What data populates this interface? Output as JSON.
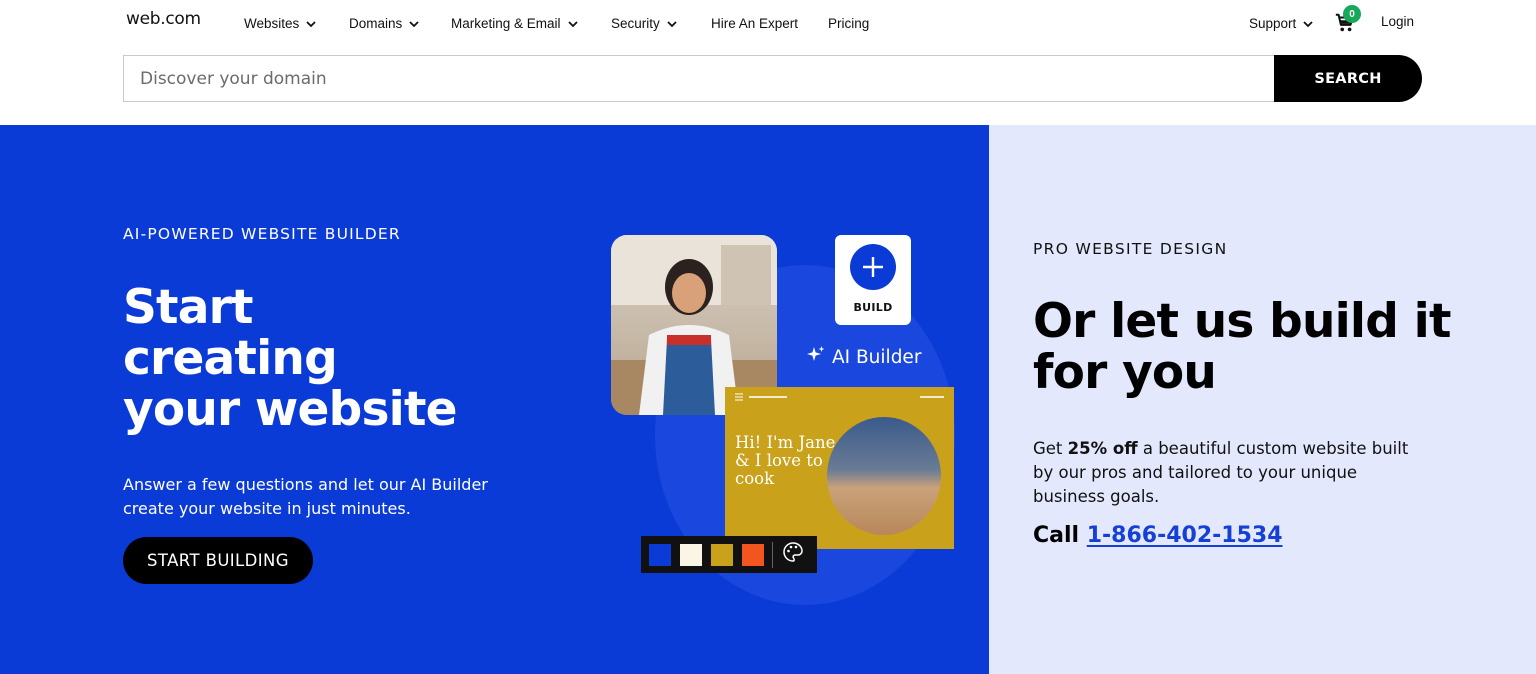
{
  "header": {
    "logo": "web.com",
    "nav": [
      {
        "label": "Websites",
        "dropdown": true
      },
      {
        "label": "Domains",
        "dropdown": true
      },
      {
        "label": "Marketing & Email",
        "dropdown": true
      },
      {
        "label": "Security",
        "dropdown": true
      },
      {
        "label": "Hire An Expert",
        "dropdown": false
      },
      {
        "label": "Pricing",
        "dropdown": false
      }
    ],
    "support_label": "Support",
    "cart_count": "0",
    "login_label": "Login"
  },
  "search": {
    "placeholder": "Discover your domain",
    "button_label": "SEARCH"
  },
  "hero": {
    "eyebrow": "AI-POWERED WEBSITE BUILDER",
    "title_lines": [
      "Start",
      "creating",
      "your website"
    ],
    "subtitle": "Answer a few questions and let our AI Builder create your website in just minutes.",
    "cta_label": "START BUILDING",
    "illustration": {
      "build_label": "BUILD",
      "ai_label": "AI Builder",
      "site_text": "Hi! I'm Jane, & I love to cook",
      "palette": [
        "#0b3bd6",
        "#fbf5e6",
        "#c9a11b",
        "#f2551e"
      ]
    }
  },
  "pro": {
    "eyebrow": "PRO WEBSITE DESIGN",
    "title": "Or let us build it for you",
    "sub_prefix": "Get ",
    "sub_bold": "25% off",
    "sub_suffix": " a beautiful custom website built by our pros and tailored to your unique business goals.",
    "call_label": "Call ",
    "phone": "1-866-402-1534"
  },
  "colors": {
    "brand_blue": "#0b3bd6",
    "panel_lavender": "#e3e8fd",
    "badge_green": "#18a85a"
  }
}
